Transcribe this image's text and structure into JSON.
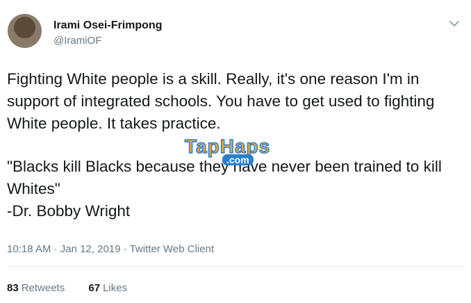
{
  "author": {
    "display_name": "Irami Osei-Frimpong",
    "handle": "@IramiOF"
  },
  "tweet": {
    "paragraph_1": "Fighting White people is a skill. Really, it's one reason I'm in support of integrated schools. You have to get used to fighting White people. It takes practice.",
    "paragraph_2": "\"Blacks kill Blacks because they have never been trained to kill Whites\"\n-Dr. Bobby Wright"
  },
  "watermark": {
    "main": "TapHaps",
    "sub": ".com"
  },
  "meta": {
    "time": "10:18 AM",
    "separator": "·",
    "date": "Jan 12, 2019",
    "client": "Twitter Web Client"
  },
  "stats": {
    "retweets_count": "83",
    "retweets_label": "Retweets",
    "likes_count": "67",
    "likes_label": "Likes"
  },
  "icons": {
    "menu": "chevron-down-icon"
  },
  "colors": {
    "text": "#14171a",
    "secondary": "#657786",
    "divider": "#e6ecf0"
  }
}
